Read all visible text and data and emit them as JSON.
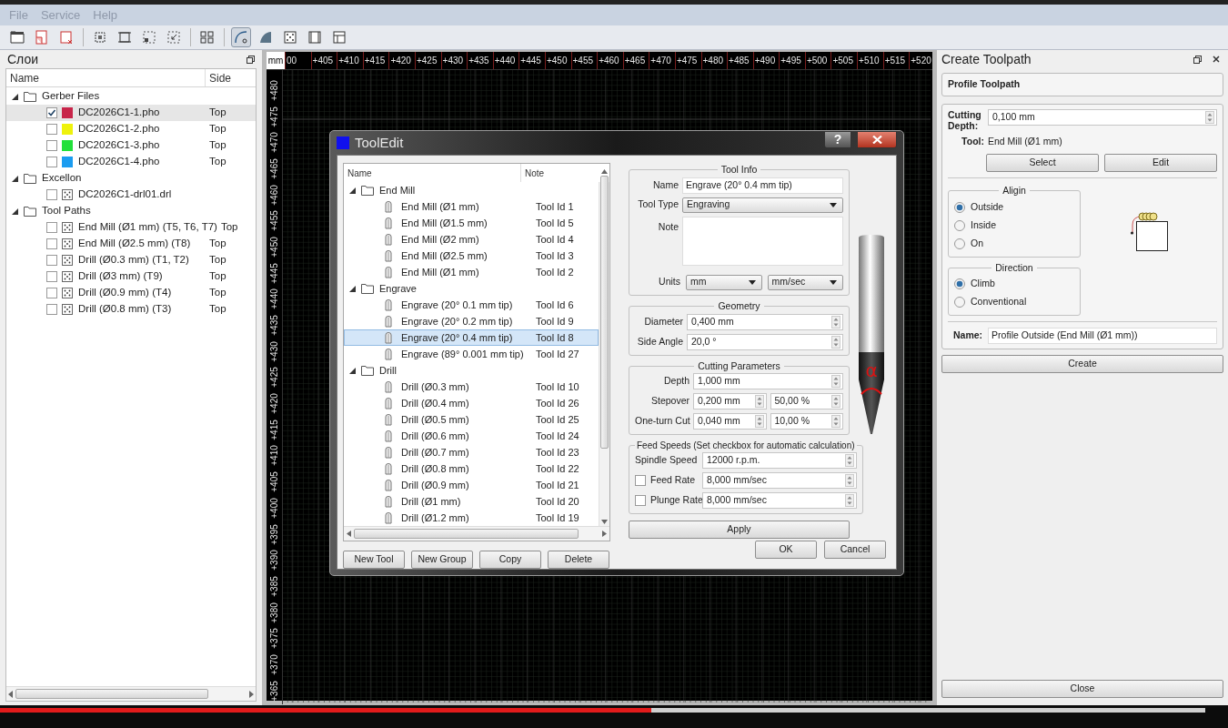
{
  "menu": [
    "File",
    "Service",
    "Help"
  ],
  "toolbar": [
    {
      "pressed": false
    },
    {
      "pressed": false
    },
    {
      "pressed": false
    },
    {
      "pressed": false
    },
    {
      "pressed": false
    },
    {
      "pressed": false
    },
    {
      "pressed": false
    },
    {
      "pressed": false
    },
    {
      "pressed": true
    },
    {
      "pressed": false
    },
    {
      "pressed": false
    },
    {
      "pressed": false
    },
    {
      "pressed": false
    }
  ],
  "layers": {
    "title": "Слои",
    "columns": [
      "Name",
      "Side"
    ],
    "groups": [
      {
        "name": "Gerber Files",
        "expanded": true,
        "children": [
          {
            "kind": "gerber",
            "name": "DC2026C1-1.pho",
            "checked": true,
            "selected": true,
            "color": "#c8254a",
            "side": "Top"
          },
          {
            "kind": "gerber",
            "name": "DC2026C1-2.pho",
            "checked": false,
            "selected": false,
            "color": "#eef20c",
            "side": "Top"
          },
          {
            "kind": "gerber",
            "name": "DC2026C1-3.pho",
            "checked": false,
            "selected": false,
            "color": "#22e03a",
            "side": "Top"
          },
          {
            "kind": "gerber",
            "name": "DC2026C1-4.pho",
            "checked": false,
            "selected": false,
            "color": "#1b9cf0",
            "side": "Top"
          }
        ]
      },
      {
        "name": "Excellon",
        "expanded": true,
        "children": [
          {
            "kind": "drill",
            "name": "DC2026C1-drl01.drl",
            "checked": false,
            "selected": false
          }
        ]
      },
      {
        "name": "Tool Paths",
        "expanded": true,
        "children": [
          {
            "kind": "path",
            "name": "End Mill (Ø1 mm) (T5, T6, T7)",
            "checked": false,
            "selected": false,
            "side": "Top"
          },
          {
            "kind": "path",
            "name": "End Mill (Ø2.5 mm) (T8)",
            "checked": false,
            "selected": false,
            "side": "Top"
          },
          {
            "kind": "path",
            "name": "Drill (Ø0.3 mm) (T1, T2)",
            "checked": false,
            "selected": false,
            "side": "Top"
          },
          {
            "kind": "path",
            "name": "Drill (Ø3 mm) (T9)",
            "checked": false,
            "selected": false,
            "side": "Top"
          },
          {
            "kind": "path",
            "name": "Drill (Ø0.9 mm) (T4)",
            "checked": false,
            "selected": false,
            "side": "Top"
          },
          {
            "kind": "path",
            "name": "Drill (Ø0.8 mm) (T3)",
            "checked": false,
            "selected": false,
            "side": "Top"
          }
        ]
      }
    ]
  },
  "ruler": {
    "unit": "mm",
    "x_labels": [
      "00",
      "+405",
      "+410",
      "+415",
      "+420",
      "+425",
      "+430",
      "+435",
      "+440",
      "+445",
      "+450",
      "+455",
      "+460",
      "+465",
      "+470",
      "+475",
      "+480",
      "+485",
      "+490",
      "+495",
      "+500",
      "+505",
      "+510",
      "+515",
      "+520"
    ],
    "y_labels": [
      "+480",
      "+475",
      "+470",
      "+465",
      "+460",
      "+455",
      "+450",
      "+445",
      "+440",
      "+435",
      "+430",
      "+425",
      "+420",
      "+415",
      "+410",
      "+405",
      "+400",
      "+395",
      "+390",
      "+385",
      "+380",
      "+375",
      "+370",
      "+365"
    ]
  },
  "tool_edit": {
    "title": "ToolEdit",
    "help_button": "?",
    "tree": {
      "columns": [
        "Name",
        "Note"
      ],
      "groups": [
        {
          "name": "End Mill",
          "expanded": true,
          "children": [
            {
              "name": "End Mill (Ø1 mm)",
              "note": "Tool Id 1",
              "selected": false
            },
            {
              "name": "End Mill (Ø1.5 mm)",
              "note": "Tool Id 5",
              "selected": false
            },
            {
              "name": "End Mill (Ø2 mm)",
              "note": "Tool Id 4",
              "selected": false
            },
            {
              "name": "End Mill (Ø2.5 mm)",
              "note": "Tool Id 3",
              "selected": false
            },
            {
              "name": "End Mill (Ø1 mm)",
              "note": "Tool Id 2",
              "selected": false
            }
          ]
        },
        {
          "name": "Engrave",
          "expanded": true,
          "children": [
            {
              "name": "Engrave (20° 0.1 mm tip)",
              "note": "Tool Id 6",
              "selected": false
            },
            {
              "name": "Engrave (20° 0.2 mm tip)",
              "note": "Tool Id 9",
              "selected": false
            },
            {
              "name": "Engrave (20° 0.4 mm tip)",
              "note": "Tool Id 8",
              "selected": true
            },
            {
              "name": "Engrave (89° 0.001 mm tip)",
              "note": "Tool Id 27",
              "selected": false
            }
          ]
        },
        {
          "name": "Drill",
          "expanded": true,
          "children": [
            {
              "name": "Drill (Ø0.3 mm)",
              "note": "Tool Id 10",
              "selected": false
            },
            {
              "name": "Drill (Ø0.4 mm)",
              "note": "Tool Id 26",
              "selected": false
            },
            {
              "name": "Drill (Ø0.5 mm)",
              "note": "Tool Id 25",
              "selected": false
            },
            {
              "name": "Drill (Ø0.6 mm)",
              "note": "Tool Id 24",
              "selected": false
            },
            {
              "name": "Drill (Ø0.7 mm)",
              "note": "Tool Id 23",
              "selected": false
            },
            {
              "name": "Drill (Ø0.8 mm)",
              "note": "Tool Id 22",
              "selected": false
            },
            {
              "name": "Drill (Ø0.9 mm)",
              "note": "Tool Id 21",
              "selected": false
            },
            {
              "name": "Drill (Ø1 mm)",
              "note": "Tool Id 20",
              "selected": false
            },
            {
              "name": "Drill (Ø1.2 mm)",
              "note": "Tool Id 19",
              "selected": false
            }
          ]
        }
      ]
    },
    "tree_buttons": [
      "New Tool",
      "New Group",
      "Copy",
      "Delete"
    ],
    "tool_info": {
      "title": "Tool Info",
      "name_label": "Name",
      "name": "Engrave (20° 0.4 mm tip)",
      "type_label": "Tool Type",
      "type": "Engraving",
      "note_label": "Note",
      "units_label": "Units",
      "units": [
        "mm",
        "mm/sec"
      ]
    },
    "geometry": {
      "title": "Geometry",
      "fields": [
        {
          "label": "Diameter",
          "value": "0,400 mm"
        },
        {
          "label": "Side Angle",
          "value": "20,0 °"
        }
      ]
    },
    "cutting": {
      "title": "Cutting Parameters",
      "fields": [
        {
          "label": "Depth",
          "values": [
            "1,000 mm"
          ]
        },
        {
          "label": "Stepover",
          "values": [
            "0,200 mm",
            "50,00 %"
          ]
        },
        {
          "label": "One-turn Cut",
          "values": [
            "0,040 mm",
            "10,00 %"
          ]
        }
      ]
    },
    "feed": {
      "title": "Feed Speeds (Set checkbox for automatic calculation)",
      "fields": [
        {
          "kind": "plain",
          "label": "Spindle Speed",
          "value": "12000 r.p.m."
        },
        {
          "kind": "checkbox",
          "label": "Feed Rate",
          "checked": false,
          "value": "8,000 mm/sec"
        },
        {
          "kind": "checkbox",
          "label": "Plunge Rate",
          "checked": false,
          "value": "8,000 mm/sec"
        }
      ]
    },
    "tool_preview": {
      "angle_symbol": "α"
    },
    "apply": "Apply",
    "ok": "OK",
    "cancel": "Cancel"
  },
  "create_toolpath": {
    "title": "Create Toolpath",
    "type": "Profile Toolpath",
    "depth_label": "Cutting Depth:",
    "depth": "0,100 mm",
    "tool_label": "Tool:",
    "tool": "End Mill (Ø1 mm)",
    "select": "Select",
    "edit": "Edit",
    "align": {
      "title": "Aligin",
      "options": [
        {
          "label": "Outside",
          "selected": true
        },
        {
          "label": "Inside",
          "selected": false
        },
        {
          "label": "On",
          "selected": false
        }
      ]
    },
    "direction": {
      "title": "Direction",
      "options": [
        {
          "label": "Climb",
          "selected": true
        },
        {
          "label": "Conventional",
          "selected": false
        }
      ]
    },
    "name_label": "Name:",
    "name": "Profile Outside (End Mill (Ø1 mm))",
    "create": "Create",
    "close": "Close"
  },
  "video": {
    "progress": {
      "level": 0.54
    }
  }
}
